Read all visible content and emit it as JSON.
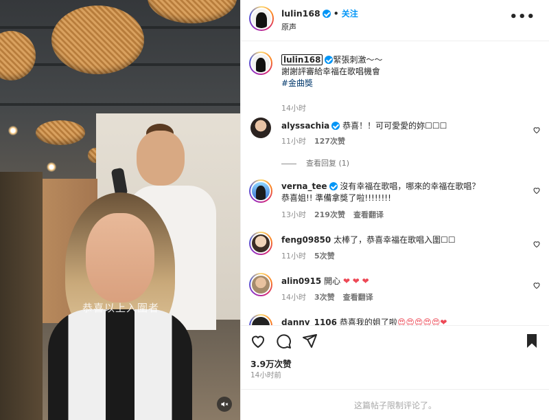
{
  "post": {
    "author": "lulin168",
    "audio": "原声",
    "follow_label": "关注",
    "separator": "•"
  },
  "caption": {
    "username": "lulin168",
    "line1": "緊張刺激～～",
    "line2": "謝謝評審給幸福在歌唱機會",
    "hashtag": "#金曲獎",
    "time": "14小时"
  },
  "comments": [
    {
      "username": "alyssachia",
      "verified": true,
      "text": "恭喜！！可可愛愛的妳☐☐☐",
      "time": "11小时",
      "likes": "127次赞",
      "reply": "",
      "view_replies": "查看回复 (1)"
    },
    {
      "username": "verna_tee",
      "verified": true,
      "text": "沒有幸福在歌唱，哪來的幸福在歌唱？",
      "text2": "恭喜姐!! 準備拿獎了啦!!!!!!!!",
      "time": "13小时",
      "likes": "219次赞",
      "reply": "查看翻译"
    },
    {
      "username": "feng09850",
      "verified": false,
      "text": "太棒了，恭喜幸福在歌唱入圍☐☐",
      "time": "11小时",
      "likes": "5次赞",
      "reply": ""
    },
    {
      "username": "alin0915",
      "verified": false,
      "text": "開心",
      "hearts": "❤ ❤ ❤",
      "time": "14小时",
      "likes": "3次赞",
      "reply": "查看翻译"
    },
    {
      "username": "danny_1106",
      "verified": false,
      "text": "恭喜我的姐了啦",
      "hearts": "😍😍😍😍😍❤",
      "time": "",
      "likes": "",
      "reply": ""
    }
  ],
  "video": {
    "overlay_caption": "恭喜以上入圍者"
  },
  "footer": {
    "likes": "3.9万次赞",
    "time": "14小时前",
    "comments_limited": "这篇帖子限制评论了。"
  },
  "colors": {
    "accent": "#0095f6",
    "text": "#262626",
    "muted": "#8e8e8e",
    "heart_red": "#ed4956"
  },
  "icons": [
    "more-icon",
    "verified-icon",
    "heart-icon",
    "comment-icon",
    "share-icon",
    "bookmark-icon",
    "mute-icon"
  ]
}
